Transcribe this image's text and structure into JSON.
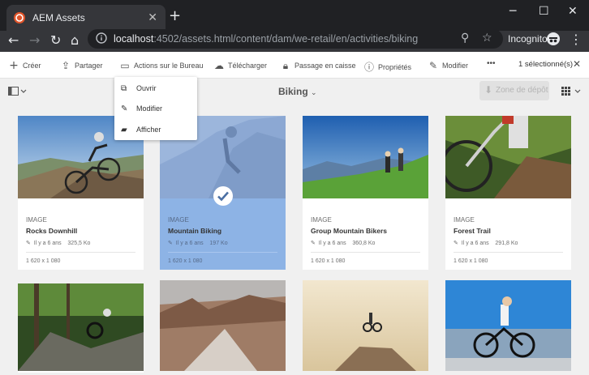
{
  "browser": {
    "tab_title": "AEM Assets",
    "url_host": "localhost",
    "url_rest": ":4502/assets.html/content/dam/we-retail/en/activities/biking",
    "incognito_label": "Incognito"
  },
  "actionbar": {
    "create": "Créer",
    "share": "Partager",
    "desktop_actions": "Actions sur le Bureau",
    "download": "Télécharger",
    "checkout": "Passage en caisse",
    "properties": "Propriétés",
    "edit": "Modifier",
    "more": "•••",
    "selected": "1 sélectionné(s)"
  },
  "dropdown": {
    "items": [
      "Ouvrir",
      "Modifier",
      "Afficher"
    ]
  },
  "subbar": {
    "breadcrumb": "Biking",
    "dropzone": "Zone de dépôt"
  },
  "cards": [
    {
      "type": "IMAGE",
      "name": "Rocks Downhill",
      "age": "Il y a 6 ans",
      "size": "325,5 Ko",
      "dims": "1 620 x 1 080"
    },
    {
      "type": "IMAGE",
      "name": "Mountain Biking",
      "age": "Il y a 6 ans",
      "size": "197 Ko",
      "dims": "1 620 x 1 080"
    },
    {
      "type": "IMAGE",
      "name": "Group Mountain Bikers",
      "age": "Il y a 6 ans",
      "size": "360,8 Ko",
      "dims": "1 620 x 1 080"
    },
    {
      "type": "IMAGE",
      "name": "Forest Trail",
      "age": "Il y a 6 ans",
      "size": "291,8 Ko",
      "dims": "1 620 x 1 080"
    }
  ],
  "colors": {
    "chrome_dark": "#202124",
    "chrome_tab": "#35363a",
    "selected_card": "#8db3e5",
    "page_bg": "#f0f0f0"
  }
}
